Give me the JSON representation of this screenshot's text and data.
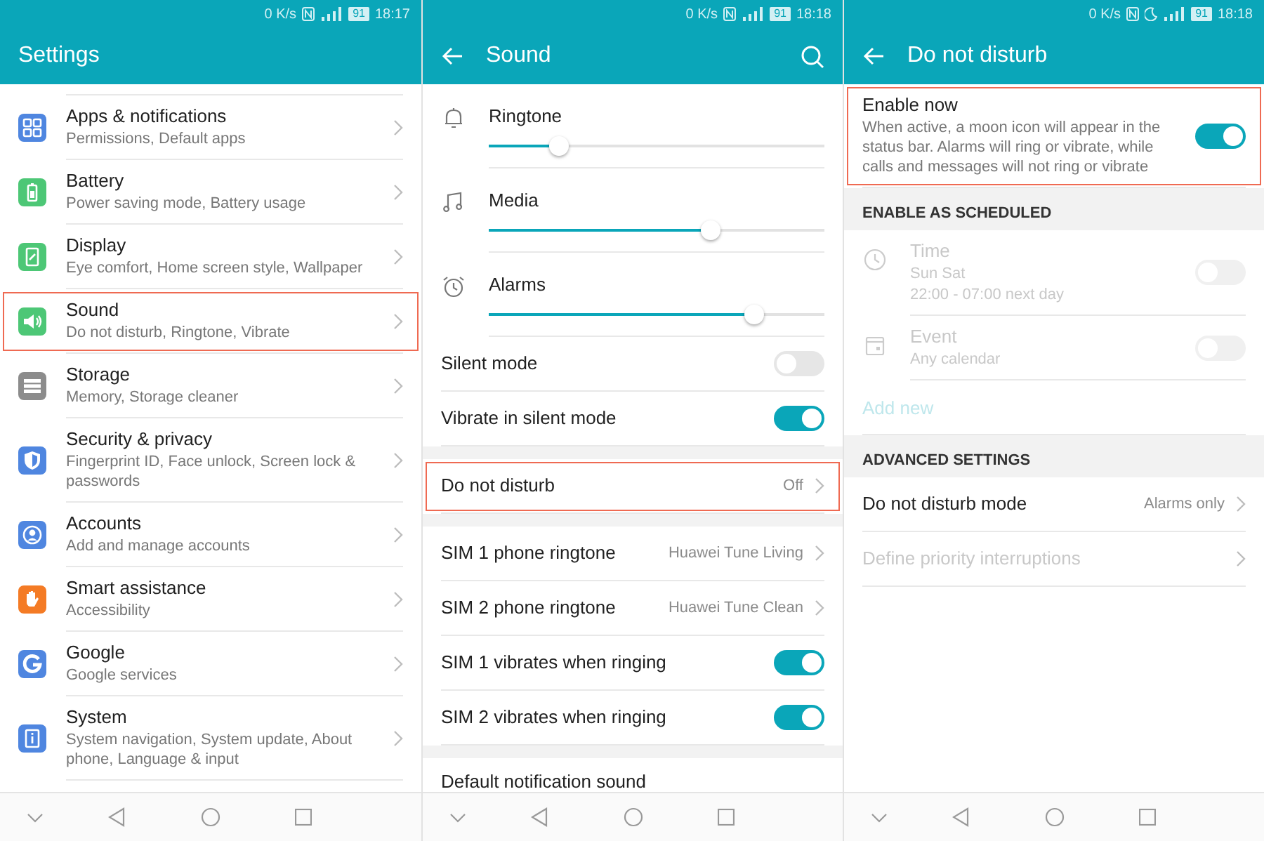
{
  "screens": [
    {
      "status_bar": {
        "speed": "0 K/s",
        "dnd_icon": false,
        "battery": "91",
        "time": "18:17"
      },
      "toolbar": {
        "title": "Settings",
        "back": false,
        "search": false
      },
      "groups": [
        {
          "rows": [
            {
              "kind": "nav",
              "icon": true,
              "color": "#4f86e0",
              "title": "Apps & notifications",
              "lines": [
                "Permissions, Default apps"
              ],
              "highlighted": false
            },
            {
              "kind": "nav",
              "icon": true,
              "color": "#4dc776",
              "title": "Battery",
              "lines": [
                "Power saving mode, Battery usage"
              ],
              "highlighted": false
            },
            {
              "kind": "nav",
              "icon": true,
              "color": "#4dc776",
              "title": "Display",
              "lines": [
                "Eye comfort, Home screen style, Wallpaper"
              ],
              "highlighted": false
            },
            {
              "kind": "nav",
              "icon": true,
              "color": "#4dc776",
              "title": "Sound",
              "lines": [
                "Do not disturb, Ringtone, Vibrate"
              ],
              "highlighted": true
            },
            {
              "kind": "nav",
              "icon": true,
              "color": "#8c8c8c",
              "title": "Storage",
              "lines": [
                "Memory, Storage cleaner"
              ],
              "highlighted": false
            },
            {
              "kind": "nav",
              "icon": true,
              "color": "#4f86e0",
              "title": "Security & privacy",
              "lines": [
                "Fingerprint ID, Face unlock, Screen lock & passwords"
              ],
              "highlighted": false
            },
            {
              "kind": "nav",
              "icon": true,
              "color": "#4f86e0",
              "title": "Accounts",
              "lines": [
                "Add and manage accounts"
              ],
              "highlighted": false
            },
            {
              "kind": "nav",
              "icon": true,
              "color": "#f47b25",
              "title": "Smart assistance",
              "lines": [
                "Accessibility"
              ],
              "highlighted": false
            },
            {
              "kind": "nav",
              "icon": true,
              "color": "#4f86e0",
              "title": "Google",
              "lines": [
                "Google services"
              ],
              "highlighted": false
            },
            {
              "kind": "nav",
              "icon": true,
              "color": "#4f86e0",
              "title": "System",
              "lines": [
                "System navigation, System update, About phone, Language & input"
              ],
              "highlighted": false
            }
          ]
        }
      ]
    },
    {
      "status_bar": {
        "speed": "0 K/s",
        "dnd_icon": false,
        "battery": "91",
        "time": "18:18"
      },
      "toolbar": {
        "title": "Sound",
        "back": true,
        "search": true
      },
      "groups": [
        {
          "rows": [
            {
              "kind": "slider",
              "icon": true,
              "title": "Ringtone",
              "level": 0.21
            },
            {
              "kind": "slider",
              "icon": true,
              "title": "Media",
              "level": 0.66
            },
            {
              "kind": "slider",
              "icon": true,
              "title": "Alarms",
              "level": 0.79
            },
            {
              "kind": "switch",
              "title": "Silent mode",
              "on": false,
              "highlighted": false
            },
            {
              "kind": "switch",
              "title": "Vibrate in silent mode",
              "on": true,
              "highlighted": false
            }
          ]
        },
        {
          "rows": [
            {
              "kind": "value",
              "title": "Do not disturb",
              "value": "Off",
              "highlighted": true
            }
          ]
        },
        {
          "rows": [
            {
              "kind": "value",
              "title": "SIM 1 phone ringtone",
              "value": "Huawei Tune Living",
              "highlighted": false
            },
            {
              "kind": "value",
              "title": "SIM 2 phone ringtone",
              "value": "Huawei Tune Clean",
              "highlighted": false
            },
            {
              "kind": "switch",
              "title": "SIM 1 vibrates when ringing",
              "on": true,
              "highlighted": false
            },
            {
              "kind": "switch",
              "title": "SIM 2 vibrates when ringing",
              "on": true,
              "highlighted": false
            }
          ]
        },
        {
          "rows": [
            {
              "kind": "title",
              "title": "Default notification sound",
              "highlighted": false
            }
          ]
        }
      ]
    },
    {
      "status_bar": {
        "speed": "0 K/s",
        "dnd_icon": true,
        "battery": "91",
        "time": "18:18"
      },
      "toolbar": {
        "title": "Do not disturb",
        "back": true,
        "search": false
      },
      "groups": [
        {
          "rows": [
            {
              "kind": "switch",
              "title": "Enable now",
              "lines": [
                "When active, a moon icon will appear in the status bar. Alarms will ring or vibrate, while calls and messages will not ring or vibrate"
              ],
              "on": true,
              "highlighted": true,
              "disabled": false
            }
          ]
        },
        {
          "header": "ENABLE AS SCHEDULED",
          "rows": [
            {
              "kind": "switch",
              "icon": true,
              "title": "Time",
              "lines": [
                "Sun Sat",
                "22:00 - 07:00 next day"
              ],
              "on": false,
              "highlighted": false,
              "disabled": true
            },
            {
              "kind": "switch",
              "icon": true,
              "title": "Event",
              "lines": [
                "Any calendar"
              ],
              "on": false,
              "highlighted": false,
              "disabled": true
            },
            {
              "kind": "link",
              "title": "Add new",
              "highlighted": false,
              "disabled": true
            }
          ]
        },
        {
          "header": "ADVANCED SETTINGS",
          "rows": [
            {
              "kind": "value",
              "title": "Do not disturb mode",
              "value": "Alarms only",
              "highlighted": false,
              "disabled": false
            },
            {
              "kind": "value",
              "title": "Define priority interruptions",
              "highlighted": false,
              "disabled": true
            }
          ]
        }
      ]
    }
  ]
}
